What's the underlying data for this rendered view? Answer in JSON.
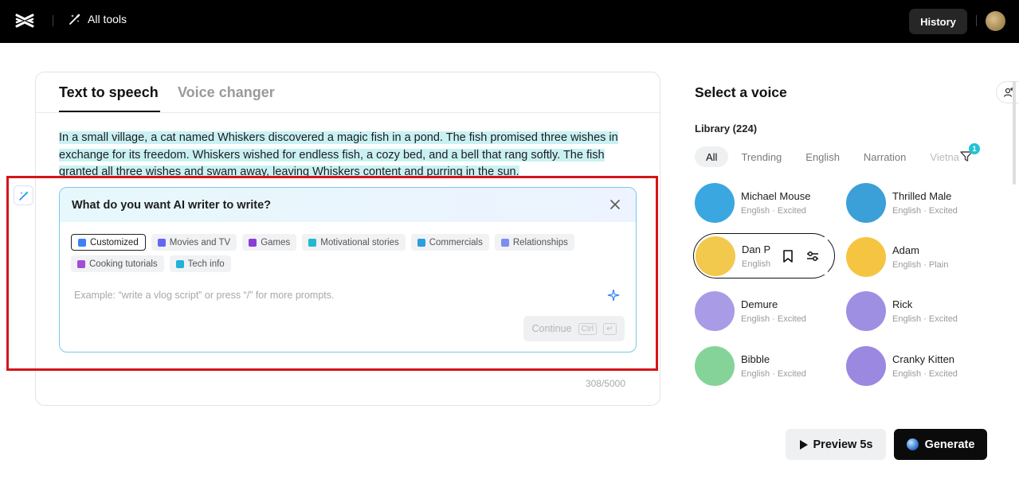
{
  "topbar": {
    "all_tools_label": "All tools",
    "history_label": "History"
  },
  "editor": {
    "tabs": [
      {
        "label": "Text to speech",
        "active": true
      },
      {
        "label": "Voice changer",
        "active": false
      }
    ],
    "story_text": "In a small village, a cat named Whiskers discovered a magic fish in a pond. The fish promised three wishes in exchange for its freedom. Whiskers wished for endless fish, a cozy bed, and a bell that rang softly. The fish granted all three wishes and swam away, leaving Whiskers content and purring in the sun.",
    "char_count": "308/5000"
  },
  "ai_writer": {
    "title": "What do you want AI writer to write?",
    "chips": [
      {
        "label": "Customized",
        "icon": "pencil-icon",
        "color": "#3b82f6",
        "active": true
      },
      {
        "label": "Movies and TV",
        "icon": "clapper-icon",
        "color": "#6366f1",
        "active": false
      },
      {
        "label": "Games",
        "icon": "gamepad-icon",
        "color": "#8b3dd9",
        "active": false
      },
      {
        "label": "Motivational stories",
        "icon": "sun-icon",
        "color": "#22b8cf",
        "active": false
      },
      {
        "label": "Commercials",
        "icon": "megaphone-icon",
        "color": "#2b9de0",
        "active": false
      },
      {
        "label": "Relationships",
        "icon": "people-icon",
        "color": "#7c8cf0",
        "active": false
      },
      {
        "label": "Cooking tutorials",
        "icon": "cup-icon",
        "color": "#a34cd6",
        "active": false
      },
      {
        "label": "Tech info",
        "icon": "rocket-icon",
        "color": "#20b2d8",
        "active": false
      }
    ],
    "placeholder": "Example: “write a vlog script” or press “/” for more prompts.",
    "continue_label": "Continue",
    "shortcut_key": "Ctrl",
    "shortcut_enter": "↵"
  },
  "voices": {
    "title": "Select a voice",
    "library_label": "Library (224)",
    "filter_tabs": [
      "All",
      "Trending",
      "English",
      "Narration",
      "Vietna"
    ],
    "filter_badge": "1",
    "items": [
      {
        "name": "Michael Mouse",
        "meta": "English · Excited",
        "avatar_color": "#3aa7e0"
      },
      {
        "name": "Thrilled Male",
        "meta": "English · Excited",
        "avatar_color": "#3ba0d8"
      },
      {
        "name": "Dan P",
        "meta": "English",
        "avatar_color": "#f2c94c"
      },
      {
        "name": "Adam",
        "meta": "English · Plain",
        "avatar_color": "#f5c542"
      },
      {
        "name": "Demure",
        "meta": "English · Excited",
        "avatar_color": "#a99be6"
      },
      {
        "name": "Rick",
        "meta": "English · Excited",
        "avatar_color": "#9f8fe3"
      },
      {
        "name": "Bibble",
        "meta": "English · Excited",
        "avatar_color": "#86d39a"
      },
      {
        "name": "Cranky Kitten",
        "meta": "English · Excited",
        "avatar_color": "#9b88e0"
      }
    ]
  },
  "actions": {
    "preview_label": "Preview 5s",
    "generate_label": "Generate"
  }
}
